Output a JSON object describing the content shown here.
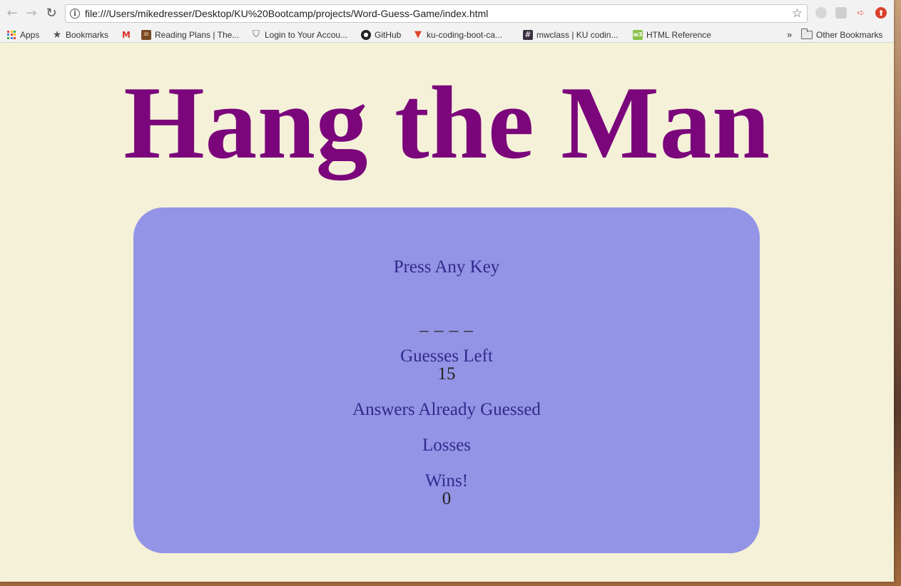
{
  "browser": {
    "url": "file:///Users/mikedresser/Desktop/KU%20Bootcamp/projects/Word-Guess-Game/index.html",
    "nav": {
      "back_icon": "←",
      "forward_icon": "→",
      "reload_icon": "↻",
      "star_icon": "☆",
      "info_icon": "i"
    },
    "bookmarks": [
      {
        "label": "Apps",
        "icon": "apps-grid"
      },
      {
        "label": "Bookmarks",
        "icon": "star"
      },
      {
        "label": "",
        "icon": "gmail"
      },
      {
        "label": "Reading Plans | The...",
        "icon": "bible"
      },
      {
        "label": "Login to Your Accou...",
        "icon": "shield"
      },
      {
        "label": "GitHub",
        "icon": "github"
      },
      {
        "label": "ku-coding-boot-ca...",
        "icon": "gitlab"
      },
      {
        "label": "mwclass | KU codin...",
        "icon": "slack"
      },
      {
        "label": "HTML Reference",
        "icon": "w3"
      }
    ],
    "overflow": "»",
    "other_bookmarks": "Other Bookmarks"
  },
  "game": {
    "title": "Hang the Man",
    "prompt": "Press Any Key",
    "word_display": "_ _ _ _",
    "guesses_left_label": "Guesses Left",
    "guesses_left_value": "15",
    "already_guessed_label": "Answers Already Guessed",
    "already_guessed_value": "",
    "losses_label": "Losses",
    "losses_value": "",
    "wins_label": "Wins!",
    "wins_value": "0"
  },
  "colors": {
    "page_bg": "#f4f1d8",
    "title": "#7b057b",
    "box_bg": "#9494e6",
    "label": "#2f2a8c"
  }
}
